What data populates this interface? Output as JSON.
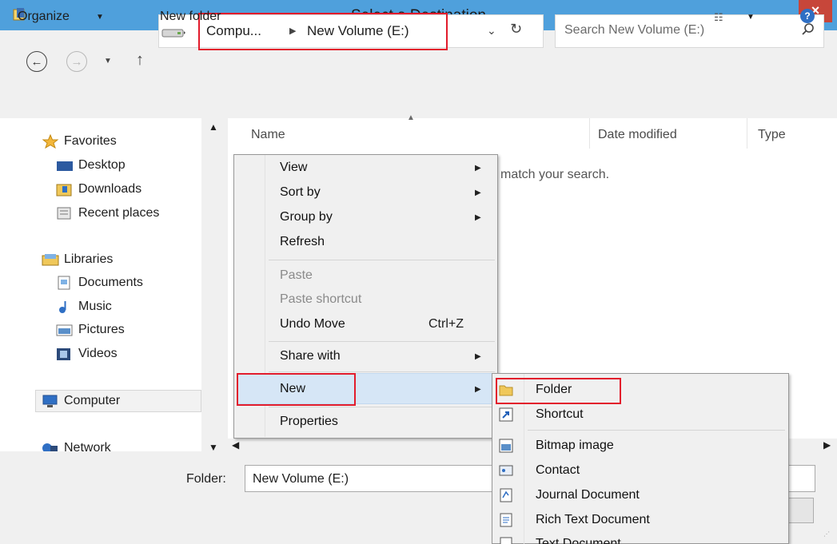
{
  "window": {
    "title": "Select a Destination",
    "close_glyph": "×"
  },
  "address_bar": {
    "back_glyph": "←",
    "forward_glyph": "→",
    "up_glyph": "↑",
    "crumbs": [
      "Compu...",
      "New Volume (E:)"
    ],
    "crumb_separator": "▶",
    "dropdown_glyph": "⌄",
    "refresh_glyph": "↻"
  },
  "search": {
    "placeholder": "Search New Volume (E:)"
  },
  "toolbar": {
    "organize_label": "Organize",
    "new_folder_label": "New folder",
    "help_glyph": "?"
  },
  "nav": {
    "favorites": {
      "label": "Favorites",
      "items": [
        {
          "label": "Desktop",
          "icon": "desktop-icon"
        },
        {
          "label": "Downloads",
          "icon": "downloads-icon"
        },
        {
          "label": "Recent places",
          "icon": "recent-places-icon"
        }
      ]
    },
    "libraries": {
      "label": "Libraries",
      "items": [
        {
          "label": "Documents",
          "icon": "documents-icon"
        },
        {
          "label": "Music",
          "icon": "music-icon"
        },
        {
          "label": "Pictures",
          "icon": "pictures-icon"
        },
        {
          "label": "Videos",
          "icon": "videos-icon"
        }
      ]
    },
    "computer": "Computer",
    "network": "Network"
  },
  "file_list": {
    "columns": [
      "Name",
      "Date modified",
      "Type"
    ],
    "empty_message": "match your search."
  },
  "bottom": {
    "folder_label": "Folder:",
    "folder_value": "New Volume (E:)"
  },
  "context_menu": {
    "items": [
      {
        "label": "View",
        "submenu": true
      },
      {
        "label": "Sort by",
        "submenu": true
      },
      {
        "label": "Group by",
        "submenu": true
      },
      {
        "label": "Refresh"
      },
      {
        "label": "Paste",
        "disabled": true
      },
      {
        "label": "Paste shortcut",
        "disabled": true
      },
      {
        "label": "Undo Move",
        "shortcut": "Ctrl+Z"
      },
      {
        "label": "Share with",
        "submenu": true
      },
      {
        "label": "New",
        "submenu": true,
        "highlighted": true
      },
      {
        "label": "Properties"
      }
    ]
  },
  "new_submenu": {
    "items": [
      {
        "label": "Folder",
        "icon": "folder-icon"
      },
      {
        "label": "Shortcut",
        "icon": "shortcut-icon"
      },
      {
        "label": "Bitmap image",
        "icon": "bitmap-image-icon"
      },
      {
        "label": "Contact",
        "icon": "contact-icon"
      },
      {
        "label": "Journal Document",
        "icon": "journal-document-icon"
      },
      {
        "label": "Rich Text Document",
        "icon": "rich-text-document-icon"
      },
      {
        "label": "Text Document",
        "icon": "text-document-icon"
      }
    ]
  },
  "colors": {
    "titlebar": "#4fa0dc",
    "close": "#c7463a",
    "highlight_box": "#e21c2c",
    "menu_hover": "#d6e6f6"
  }
}
